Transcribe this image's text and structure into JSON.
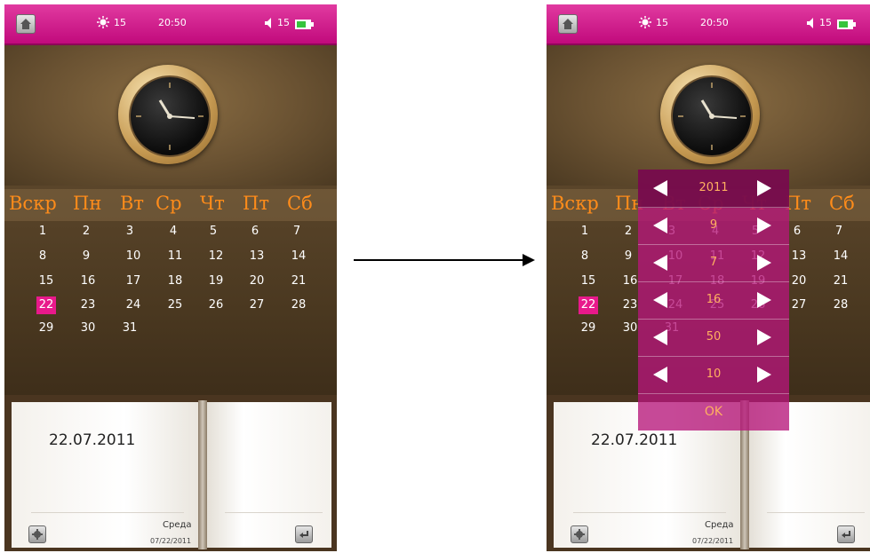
{
  "status": {
    "brightness": "15",
    "time": "20:50",
    "volume": "15"
  },
  "calendar": {
    "weekdays": [
      "Вскр",
      "Пн",
      "Вт",
      "Ср",
      "Чт",
      "Пт",
      "Сб"
    ],
    "weeks": [
      [
        "1",
        "2",
        "3",
        "4",
        "5",
        "6",
        "7"
      ],
      [
        "8",
        "9",
        "10",
        "11",
        "12",
        "13",
        "14"
      ],
      [
        "15",
        "16",
        "17",
        "18",
        "19",
        "20",
        "21"
      ],
      [
        "22",
        "23",
        "24",
        "25",
        "26",
        "27",
        "28"
      ],
      [
        "29",
        "30",
        "31",
        "",
        "",
        "",
        ""
      ]
    ],
    "today": "22"
  },
  "notebook": {
    "date_big": "22.07.2011",
    "weekday_name": "Среда",
    "date_small": "07/22/2011"
  },
  "picker": {
    "values": [
      "2011",
      "9",
      "7",
      "16",
      "50",
      "10"
    ],
    "ok_label": "OK"
  },
  "colors": {
    "topbar": "#c10a7c",
    "today": "#e8198b",
    "weekday_text": "#ff8c1a",
    "picker_value": "#ffb060"
  }
}
